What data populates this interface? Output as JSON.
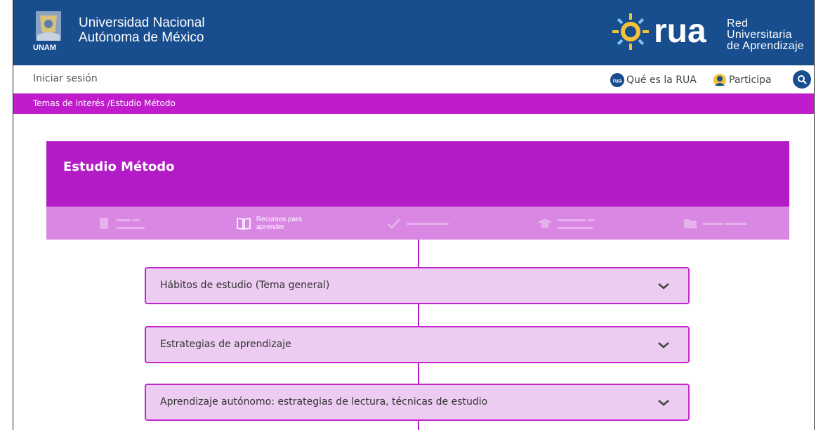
{
  "header": {
    "unam_name_line1": "Universidad Nacional",
    "unam_name_line2": "Autónoma de México",
    "unam_logo_label": "UNAM",
    "rua_logo_label": "rua",
    "rua_name_line1": "Red Universitaria",
    "rua_name_line2": "de Aprendizaje",
    "bg_color": "#184d8e"
  },
  "nav": {
    "login": "Iniciar sesión",
    "about": "Qué es la RUA",
    "participate": "Participa",
    "search_icon": "search-icon"
  },
  "breadcrumb": {
    "text": "Temas de interés /Estudio Método",
    "color": "#c01ccb"
  },
  "page": {
    "title": "Estudio Método",
    "accent": "#b31bc6",
    "tabs": [
      {
        "label": "",
        "icon": "document-icon",
        "active": false
      },
      {
        "label_line1": "Recursos para",
        "label_line2": "aprender",
        "icon": "book-icon",
        "active": true
      },
      {
        "label": "",
        "icon": "checkmark-icon",
        "active": false
      },
      {
        "label": "",
        "icon": "graduation-cap-icon",
        "active": false
      },
      {
        "label": "",
        "icon": "folder-icon",
        "active": false
      }
    ]
  },
  "accordion": {
    "items": [
      {
        "label": "Hábitos de estudio (Tema general)"
      },
      {
        "label": "Estrategias de aprendizaje"
      },
      {
        "label": "Aprendizaje autónomo: estrategias de lectura, técnicas de estudio"
      }
    ]
  }
}
